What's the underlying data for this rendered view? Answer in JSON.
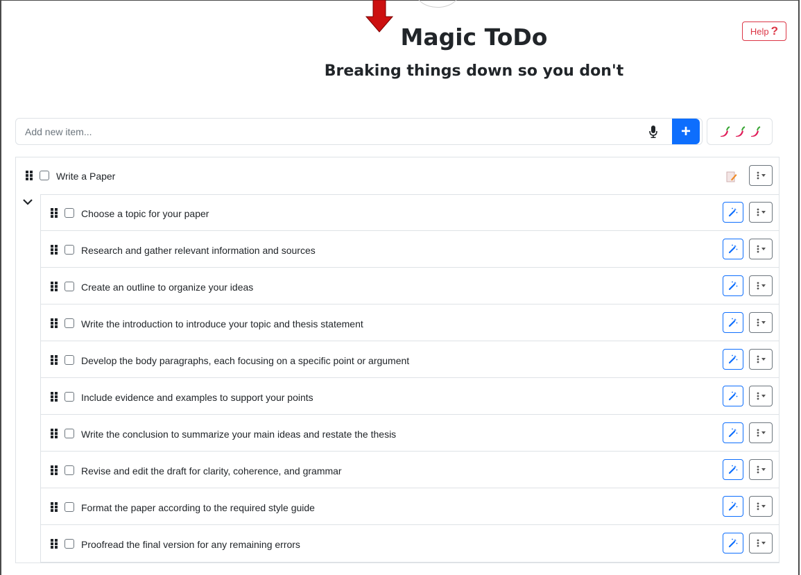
{
  "app": {
    "title": "Magic ToDo",
    "subtitle": "Breaking things down so you don't",
    "help_label": "Help",
    "help_icon": "question-mark-icon"
  },
  "new_item": {
    "placeholder": "Add new item...",
    "mic_icon": "microphone-icon",
    "add_label": "+",
    "spiciness_icon": "chili-pepper-icon",
    "spiciness_level": 3
  },
  "colors": {
    "accent": "#0d6efd",
    "danger": "#dc3545",
    "pointer_arrow": "#cc1010"
  },
  "parent": {
    "label": "Write a Paper",
    "checked": false,
    "expanded": true,
    "note_icon": "document-edit-icon"
  },
  "subtasks": [
    {
      "label": "Choose a topic for your paper",
      "checked": false
    },
    {
      "label": "Research and gather relevant information and sources",
      "checked": false
    },
    {
      "label": "Create an outline to organize your ideas",
      "checked": false
    },
    {
      "label": "Write the introduction to introduce your topic and thesis statement",
      "checked": false
    },
    {
      "label": "Develop the body paragraphs, each focusing on a specific point or argument",
      "checked": false
    },
    {
      "label": "Include evidence and examples to support your points",
      "checked": false
    },
    {
      "label": "Write the conclusion to summarize your main ideas and restate the thesis",
      "checked": false
    },
    {
      "label": "Revise and edit the draft for clarity, coherence, and grammar",
      "checked": false
    },
    {
      "label": "Format the paper according to the required style guide",
      "checked": false
    },
    {
      "label": "Proofread the final version for any remaining errors",
      "checked": false
    }
  ]
}
